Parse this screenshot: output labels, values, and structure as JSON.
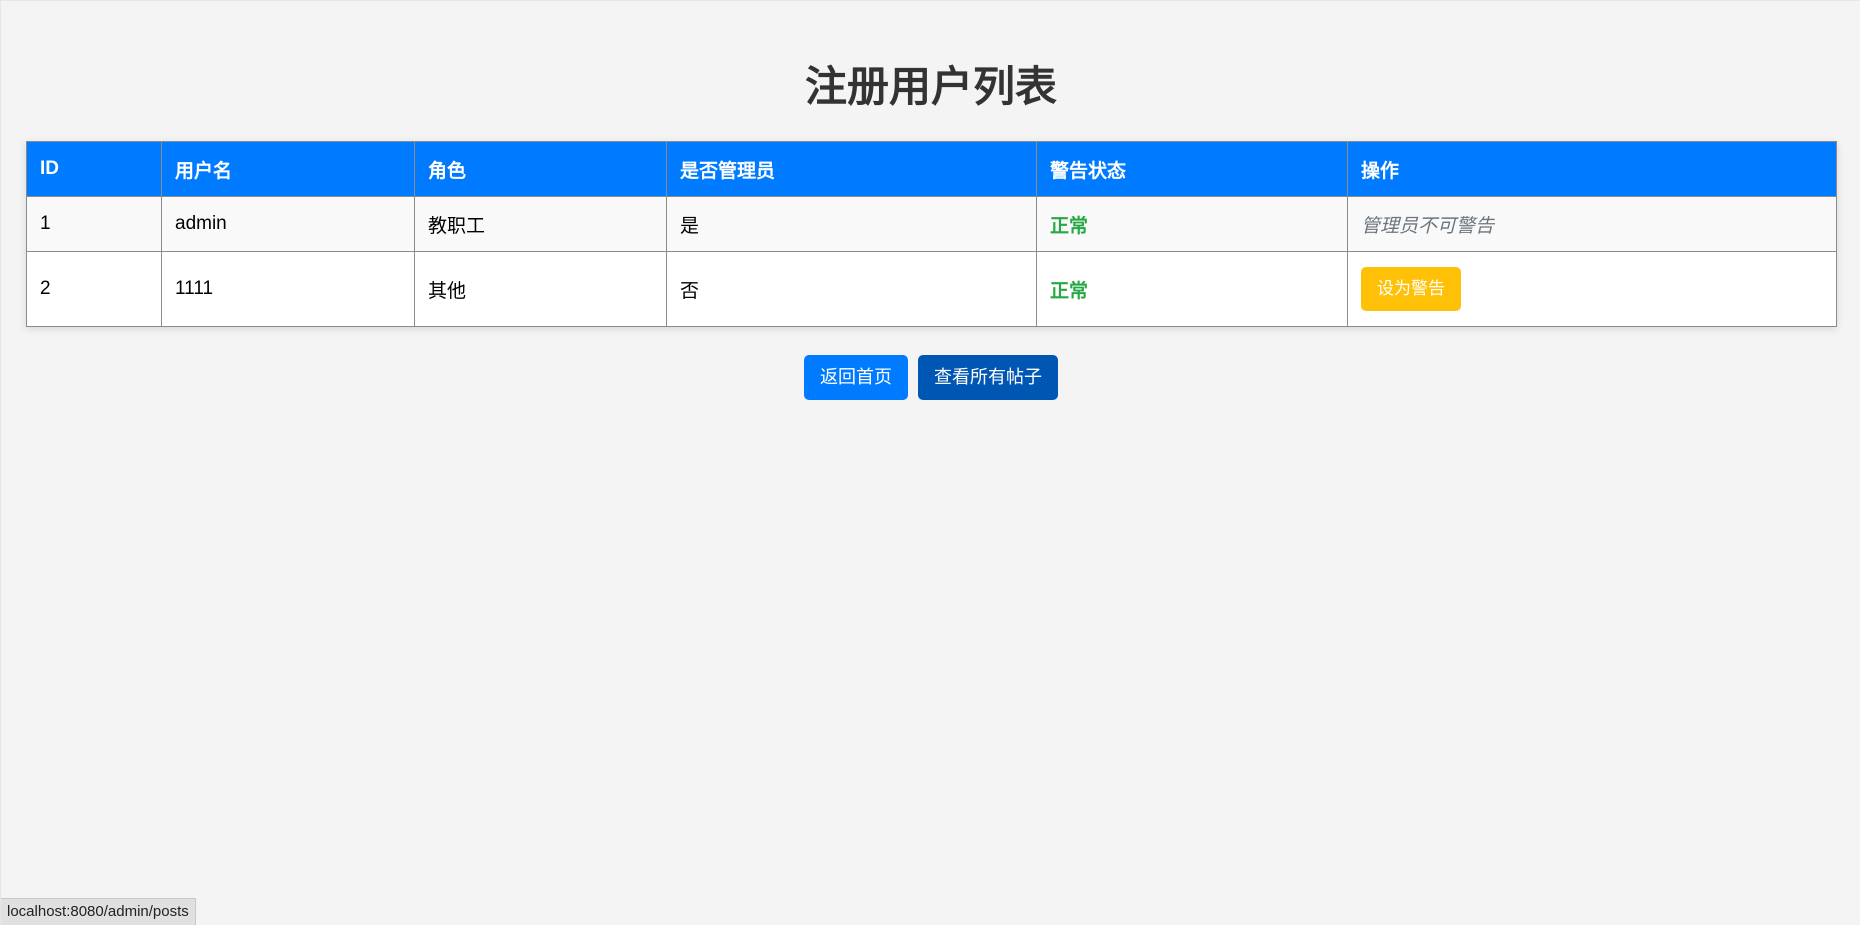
{
  "page": {
    "title": "注册用户列表"
  },
  "table": {
    "headers": [
      "ID",
      "用户名",
      "角色",
      "是否管理员",
      "警告状态",
      "操作"
    ],
    "rows": [
      {
        "id": "1",
        "username": "admin",
        "role": "教职工",
        "is_admin": "是",
        "warning_status": "正常",
        "action_text": "管理员不可警告"
      },
      {
        "id": "2",
        "username": "1111",
        "role": "其他",
        "is_admin": "否",
        "warning_status": "正常",
        "action_button": "设为警告"
      }
    ]
  },
  "actions": {
    "home_label": "返回首页",
    "posts_label": "查看所有帖子"
  },
  "status_bar": {
    "url": "localhost:8080/admin/posts"
  },
  "colors": {
    "header_bg": "#007bff",
    "status_normal": "#28a745",
    "warn_button": "#ffc107",
    "home_button": "#007bff",
    "posts_button": "#0056b3"
  }
}
